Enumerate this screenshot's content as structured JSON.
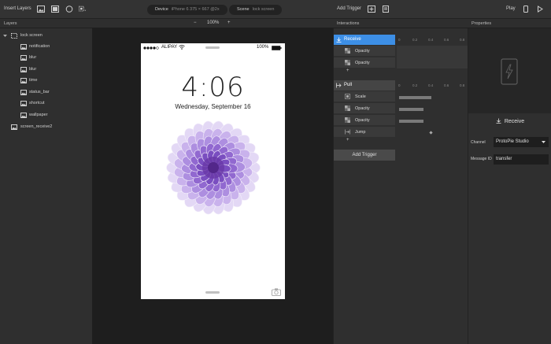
{
  "toolbar": {
    "insert_layers": "Insert Layers",
    "device_label": "Device",
    "device_value": "iPhone 6  375 × 667  @2x",
    "scene_label": "Scene",
    "scene_value": "lock screen",
    "add_trigger": "Add Trigger",
    "play": "Play"
  },
  "layers_panel": {
    "title": "Layers",
    "items": [
      {
        "label": "lock screen"
      },
      {
        "label": "notification"
      },
      {
        "label": "blur"
      },
      {
        "label": "blur"
      },
      {
        "label": "time"
      },
      {
        "label": "status_bar"
      },
      {
        "label": "shortcut"
      },
      {
        "label": "wallpaper"
      },
      {
        "label": "screen_receive2"
      }
    ]
  },
  "canvas": {
    "zoom_minus": "−",
    "zoom": "100%",
    "zoom_plus": "+",
    "phone": {
      "carrier": "ALIPAY",
      "battery": "100%",
      "time": "4:06",
      "date": "Wednesday, September 16"
    }
  },
  "interactions_panel": {
    "title": "Interactions",
    "ruler": [
      "0",
      "0.2",
      "0.4",
      "0.6",
      "0.8"
    ],
    "triggers": [
      {
        "name": "Receive",
        "responses": [
          {
            "label": "Opacity"
          },
          {
            "label": "Opacity"
          }
        ],
        "add": "+"
      },
      {
        "name": "Pull",
        "responses": [
          {
            "label": "Scale"
          },
          {
            "label": "Opacity"
          },
          {
            "label": "Opacity"
          },
          {
            "label": "Jump"
          }
        ],
        "add": "+"
      }
    ],
    "add_trigger": "Add Trigger"
  },
  "properties_panel": {
    "title": "Properties",
    "trigger_title": "Receive",
    "channel_label": "Channel",
    "channel_value": "ProtoPie Studio",
    "message_label": "Message ID",
    "message_value": "transfer"
  },
  "colors": {
    "accent_blue": "#3d8fe6",
    "flower": "#a07bd8"
  }
}
